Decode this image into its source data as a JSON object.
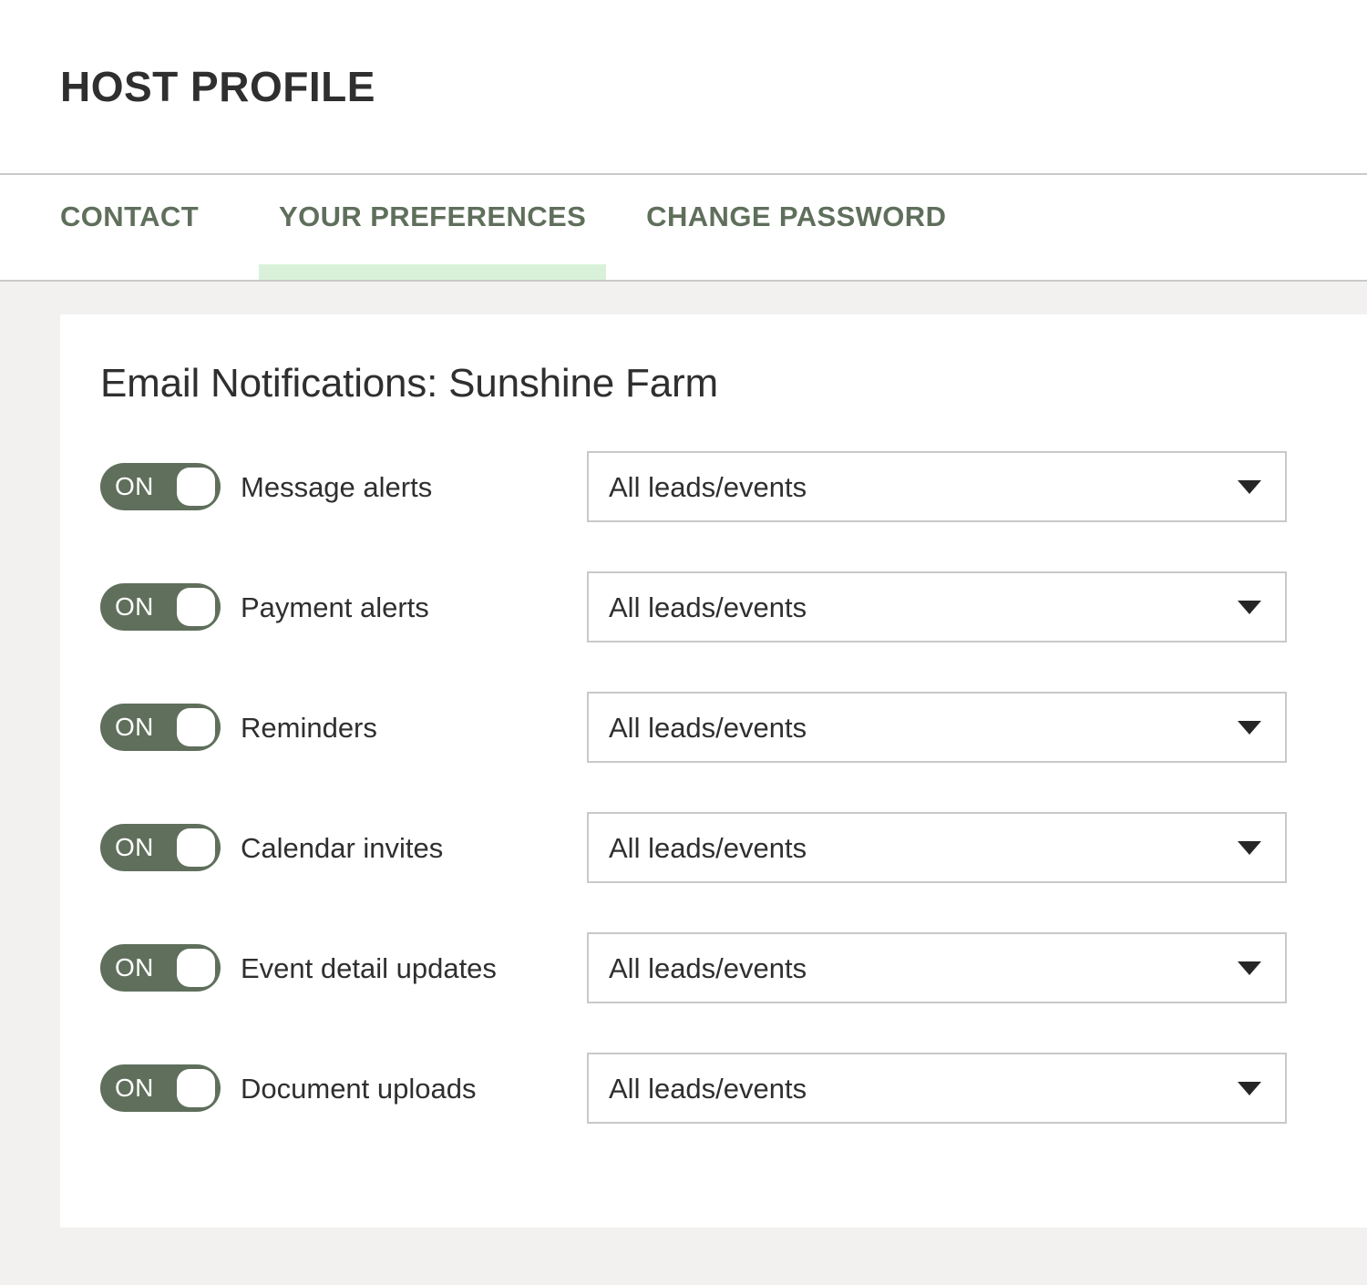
{
  "header": {
    "title": "HOST PROFILE"
  },
  "tabs": [
    {
      "label": "CONTACT",
      "active": false
    },
    {
      "label": "YOUR PREFERENCES",
      "active": true
    },
    {
      "label": "CHANGE PASSWORD",
      "active": false
    }
  ],
  "card": {
    "title": "Email Notifications: Sunshine Farm",
    "rows": [
      {
        "toggle_state": "ON",
        "label": "Message alerts",
        "select_value": "All leads/events"
      },
      {
        "toggle_state": "ON",
        "label": "Payment alerts",
        "select_value": "All leads/events"
      },
      {
        "toggle_state": "ON",
        "label": "Reminders",
        "select_value": "All leads/events"
      },
      {
        "toggle_state": "ON",
        "label": "Calendar invites",
        "select_value": "All leads/events"
      },
      {
        "toggle_state": "ON",
        "label": "Event detail updates",
        "select_value": "All leads/events"
      },
      {
        "toggle_state": "ON",
        "label": "Document uploads",
        "select_value": "All leads/events"
      }
    ]
  },
  "colors": {
    "accent_green": "#5F6F5C",
    "active_tab_underline": "#D9F1D9",
    "page_background": "#F2F1EF",
    "card_background": "#FFFFFF",
    "text_dark": "#2F2F2F",
    "border_gray": "#C9C9C9"
  },
  "icons": {
    "dropdown_caret": "chevron-down-icon"
  }
}
